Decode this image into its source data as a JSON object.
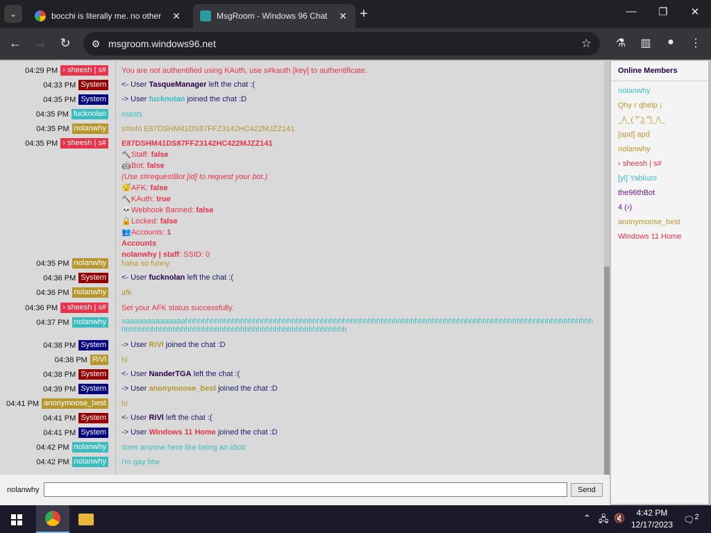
{
  "browser": {
    "tabs": [
      {
        "title": "bocchi is literally me. no other",
        "active": false
      },
      {
        "title": "MsgRoom - Windows 96 Chat",
        "active": true
      }
    ],
    "url": "msgroom.windows96.net",
    "icons": {
      "menu": "chevron-down-icon",
      "newtab": "plus-icon",
      "back": "back-arrow-icon",
      "forward": "forward-arrow-icon",
      "reload": "reload-icon",
      "site": "site-settings-icon",
      "bookmark": "star-icon",
      "labs": "flask-icon",
      "sidepanel": "side-panel-icon",
      "profile": "profile-icon",
      "more": "more-vert-icon"
    }
  },
  "chat": {
    "messages": [
      {
        "time": "04:29 PM",
        "author": "› sheesh | s#",
        "author_color": "#e8334a",
        "lines": [
          {
            "text": "You are not authentified using KAuth, use s#kauth [key] to authentificate.",
            "color": "#e8334a"
          }
        ]
      },
      {
        "time": "04:33 PM",
        "author": "System",
        "author_color": "#990000",
        "system_pre": "<- User",
        "system_user": "TasqueManager",
        "system_user_color": "#2a004a",
        "system_post": "left the chat :(",
        "text_color": "#1a1a6a"
      },
      {
        "time": "04:35 PM",
        "author": "System",
        "author_color": "#000080",
        "system_pre": "-> User",
        "system_user": "fucknolan",
        "system_user_color": "#3bbcc0",
        "system_post": "joined the chat :D",
        "text_color": "#1a1a6a"
      },
      {
        "time": "04:35 PM",
        "author": "fucknolan",
        "author_color": "#3bbcc0",
        "lines": [
          {
            "text": "roasts",
            "color": "#3bbcc0",
            "italic": true
          }
        ]
      },
      {
        "time": "04:35 PM",
        "author": "nolanwhy",
        "author_color": "#b8962e",
        "lines": [
          {
            "text": "s#info E87DSHM41DS87FFZ3142HC422MJZZ141",
            "color": "#b8962e"
          }
        ]
      },
      {
        "time": "04:35 PM",
        "author": "› sheesh | s#",
        "author_color": "#e8334a",
        "lines": [
          {
            "text": "E87DSHM41DS87FFZ3142HC422MJZZ141",
            "color": "#e8334a",
            "bold": true
          },
          {
            "icon": "hammer-icon",
            "glyph": "🔨",
            "label": "Staff:",
            "value": "false",
            "color": "#e8334a"
          },
          {
            "icon": "robot-icon",
            "glyph": "🤖",
            "label": "Bot:",
            "value": "false",
            "color": "#e8334a"
          },
          {
            "text": "(Use s#requestBot [id] to request your bot.)",
            "color": "#e8334a",
            "italic": true
          },
          {
            "icon": "sleepy-face-icon",
            "glyph": "😴",
            "label": "AFK:",
            "value": "false",
            "color": "#e8334a"
          },
          {
            "icon": "hammer-icon",
            "glyph": "🔨",
            "label": "KAuth:",
            "value": "true",
            "color": "#e8334a"
          },
          {
            "icon": "skull-icon",
            "glyph": "💀",
            "label": "Webhook Banned:",
            "value": "false",
            "color": "#e8334a"
          },
          {
            "icon": "lock-icon",
            "glyph": "🔒",
            "label": "Locked:",
            "value": "false",
            "color": "#e8334a"
          },
          {
            "icon": "users-icon",
            "glyph": "👥",
            "label": "Accounts:",
            "value": "1",
            "color": "#e8334a"
          },
          {
            "text": "Accounts",
            "color": "#e8334a",
            "bold": true
          },
          {
            "label_bold": "nolanwhy | staff",
            "rest": ": SSID: 0",
            "color": "#e8334a"
          }
        ]
      },
      {
        "time": "04:35 PM",
        "author": "nolanwhy",
        "author_color": "#b8962e",
        "lines": [
          {
            "text": "haha so funny",
            "color": "#b8962e"
          }
        ]
      },
      {
        "time": "04:36 PM",
        "author": "System",
        "author_color": "#990000",
        "system_pre": "<- User",
        "system_user": "fucknolan",
        "system_user_color": "#2a004a",
        "system_post": "left the chat :(",
        "text_color": "#1a1a6a"
      },
      {
        "time": "04:36 PM",
        "author": "nolanwhy",
        "author_color": "#b8962e",
        "lines": [
          {
            "text": "afk",
            "color": "#b8962e"
          }
        ]
      },
      {
        "time": "04:36 PM",
        "author": "› sheesh | s#",
        "author_color": "#e8334a",
        "lines": [
          {
            "text": "Set your AFK status successfully.",
            "color": "#e8334a"
          }
        ]
      },
      {
        "time": "04:37 PM",
        "author": "nolanwhy",
        "author_color": "#3bbcc0",
        "lines": [
          {
            "text": "aaaaaaaaaaaaaaahhhhhhhhhhhhhhhhhhhhhhhhhhhhhhhhhhhhhhhhhhhhhhhhhhhhhhhhhhhhhhhhhhhhhhhhhhhhhhhhhhhhhhhhhhhhhhhhhhhhhhhhhhhhhhhhhhhhhhhhhhhhhhhhhhhhhhhhhhhhhhhhhhhhh",
            "color": "#3bbcc0"
          }
        ]
      },
      {
        "time": "04:38 PM",
        "author": "System",
        "author_color": "#000080",
        "system_pre": "-> User",
        "system_user": "RiVl",
        "system_user_color": "#b8962e",
        "system_post": "joined the chat :D",
        "text_color": "#1a1a6a"
      },
      {
        "time": "04:38 PM",
        "author": "RiVl",
        "author_color": "#b8962e",
        "lines": [
          {
            "text": "hi",
            "color": "#b8962e"
          }
        ]
      },
      {
        "time": "04:38 PM",
        "author": "System",
        "author_color": "#990000",
        "system_pre": "<- User",
        "system_user": "NanderTGA",
        "system_user_color": "#2a004a",
        "system_post": "left the chat :(",
        "text_color": "#1a1a6a"
      },
      {
        "time": "04:39 PM",
        "author": "System",
        "author_color": "#000080",
        "system_pre": "-> User",
        "system_user": "anonymoose_best",
        "system_user_color": "#b8962e",
        "system_post": "joined the chat :D",
        "text_color": "#1a1a6a"
      },
      {
        "time": "04:41 PM",
        "author": "anonymoose_best",
        "author_color": "#b8962e",
        "lines": [
          {
            "text": "hi",
            "color": "#b8962e"
          }
        ]
      },
      {
        "time": "04:41 PM",
        "author": "System",
        "author_color": "#990000",
        "system_pre": "<- User",
        "system_user": "RiVl",
        "system_user_color": "#2a004a",
        "system_post": "left the chat :(",
        "text_color": "#1a1a6a"
      },
      {
        "time": "04:41 PM",
        "author": "System",
        "author_color": "#000080",
        "system_pre": "-> User",
        "system_user": "Windows 11 Home",
        "system_user_color": "#e8334a",
        "system_post": "joined the chat :D",
        "text_color": "#1a1a6a"
      },
      {
        "time": "04:42 PM",
        "author": "nolanwhy",
        "author_color": "#3bbcc0",
        "lines": [
          {
            "text": "does anyone here like being an idiot/",
            "color": "#3bbcc0"
          }
        ]
      },
      {
        "time": "04:42 PM",
        "author": "nolanwhy",
        "author_color": "#3bbcc0",
        "lines": [
          {
            "text": "i'm gay btw",
            "color": "#3bbcc0"
          }
        ]
      }
    ]
  },
  "sidebar": {
    "title": "Online Members",
    "members": [
      {
        "name": "nolanwhy",
        "color": "#3bbcc0"
      },
      {
        "name": "Qhy r qhelp ¡",
        "color": "#b8962e"
      },
      {
        "name": "_/\\_( ͡° ͜ʖ ͡°)_/\\_",
        "color": "#b8962e"
      },
      {
        "name": "[apd] apd",
        "color": "#b8962e"
      },
      {
        "name": "nolanwhy",
        "color": "#b8962e"
      },
      {
        "name": "› sheesh | s#",
        "color": "#e8334a"
      },
      {
        "name": "[yl] Yabluzo",
        "color": "#3bbcc0"
      },
      {
        "name": "the96thBot",
        "color": "#6a1a8a"
      },
      {
        "name": "4 (›)",
        "color": "#6a1a8a"
      },
      {
        "name": "anonymoose_best",
        "color": "#b8962e"
      },
      {
        "name": "Windows 11 Home",
        "color": "#e8334a"
      }
    ]
  },
  "input": {
    "username": "nolanwhy",
    "value": "",
    "send_label": "Send"
  },
  "taskbar": {
    "time": "4:42 PM",
    "date": "12/17/2023",
    "notifications": "2"
  }
}
